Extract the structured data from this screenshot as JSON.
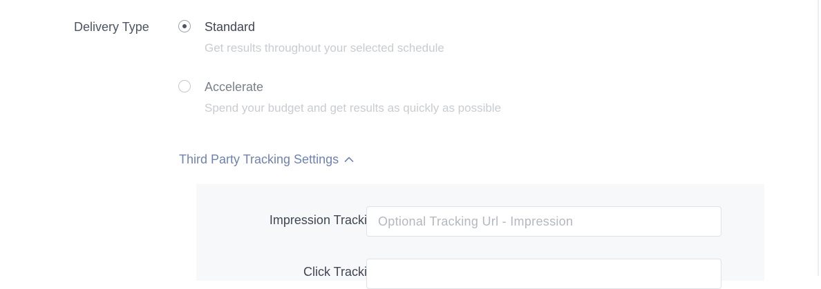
{
  "delivery": {
    "label": "Delivery Type",
    "options": [
      {
        "title": "Standard",
        "description": "Get results throughout your selected schedule",
        "checked": true
      },
      {
        "title": "Accelerate",
        "description": "Spend your budget and get results as quickly as possible",
        "checked": false
      }
    ]
  },
  "tracking": {
    "toggle_label": "Third Party Tracking Settings",
    "toggle_icon": "chevron-up-icon",
    "link_color": "#6e82b0",
    "fields": [
      {
        "label": "Impression Tracking URL",
        "placeholder": "Optional Tracking Url - Impression",
        "value": ""
      },
      {
        "label": "Click Tracking URL",
        "placeholder": "",
        "value": ""
      }
    ]
  }
}
